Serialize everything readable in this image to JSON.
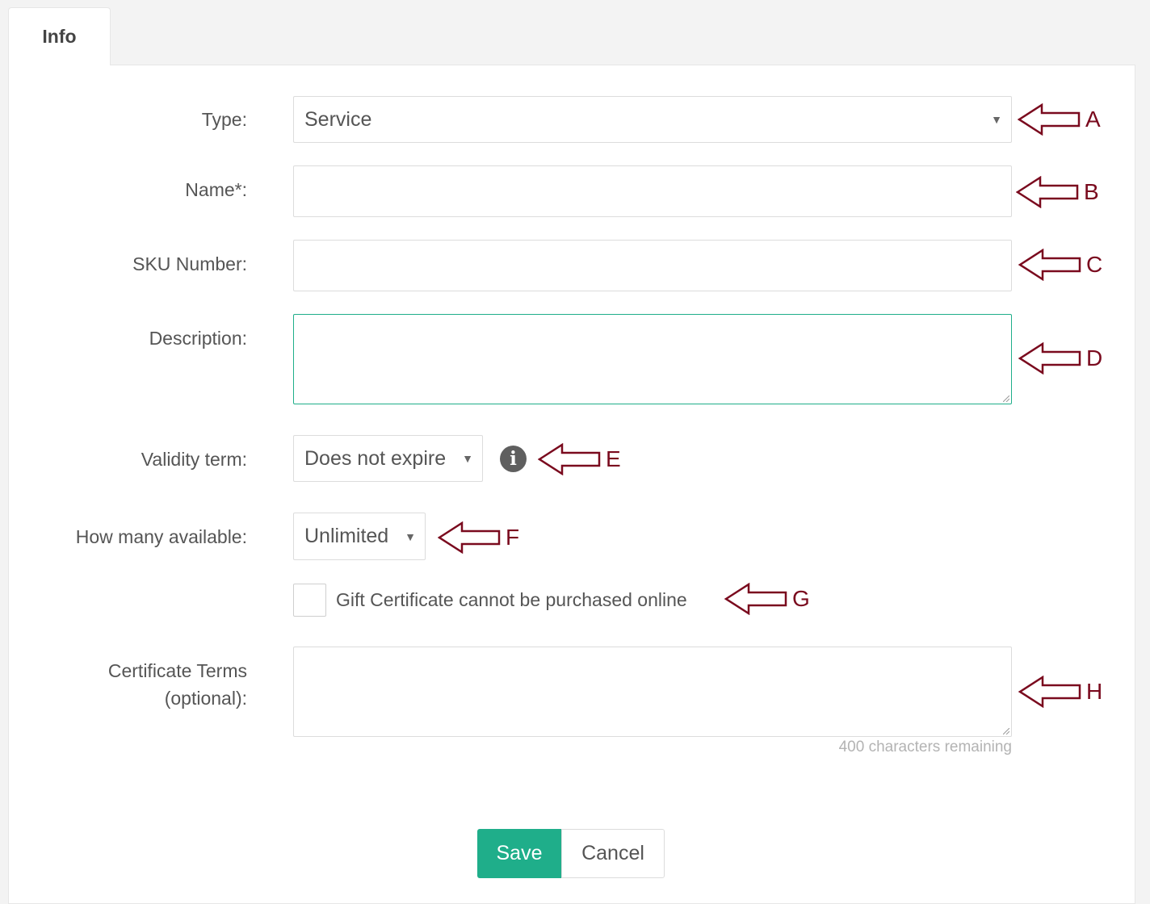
{
  "tab": {
    "label": "Info"
  },
  "form": {
    "type": {
      "label": "Type:",
      "value": "Service"
    },
    "name": {
      "label": "Name*:",
      "value": ""
    },
    "sku": {
      "label": "SKU Number:",
      "value": ""
    },
    "description": {
      "label": "Description:",
      "value": ""
    },
    "validity": {
      "label": "Validity term:",
      "value": "Does not expire"
    },
    "available": {
      "label": "How many available:",
      "value": "Unlimited"
    },
    "online_checkbox": {
      "label": "Gift Certificate cannot be purchased online",
      "checked": false
    },
    "terms": {
      "label": "Certificate Terms (optional):",
      "value": "",
      "remaining": "400 characters remaining"
    }
  },
  "buttons": {
    "save": "Save",
    "cancel": "Cancel"
  },
  "annotations": {
    "a": "A",
    "b": "B",
    "c": "C",
    "d": "D",
    "e": "E",
    "f": "F",
    "g": "G",
    "h": "H"
  },
  "colors": {
    "accent": "#1fae8a",
    "annotation": "#7a0a1e"
  }
}
